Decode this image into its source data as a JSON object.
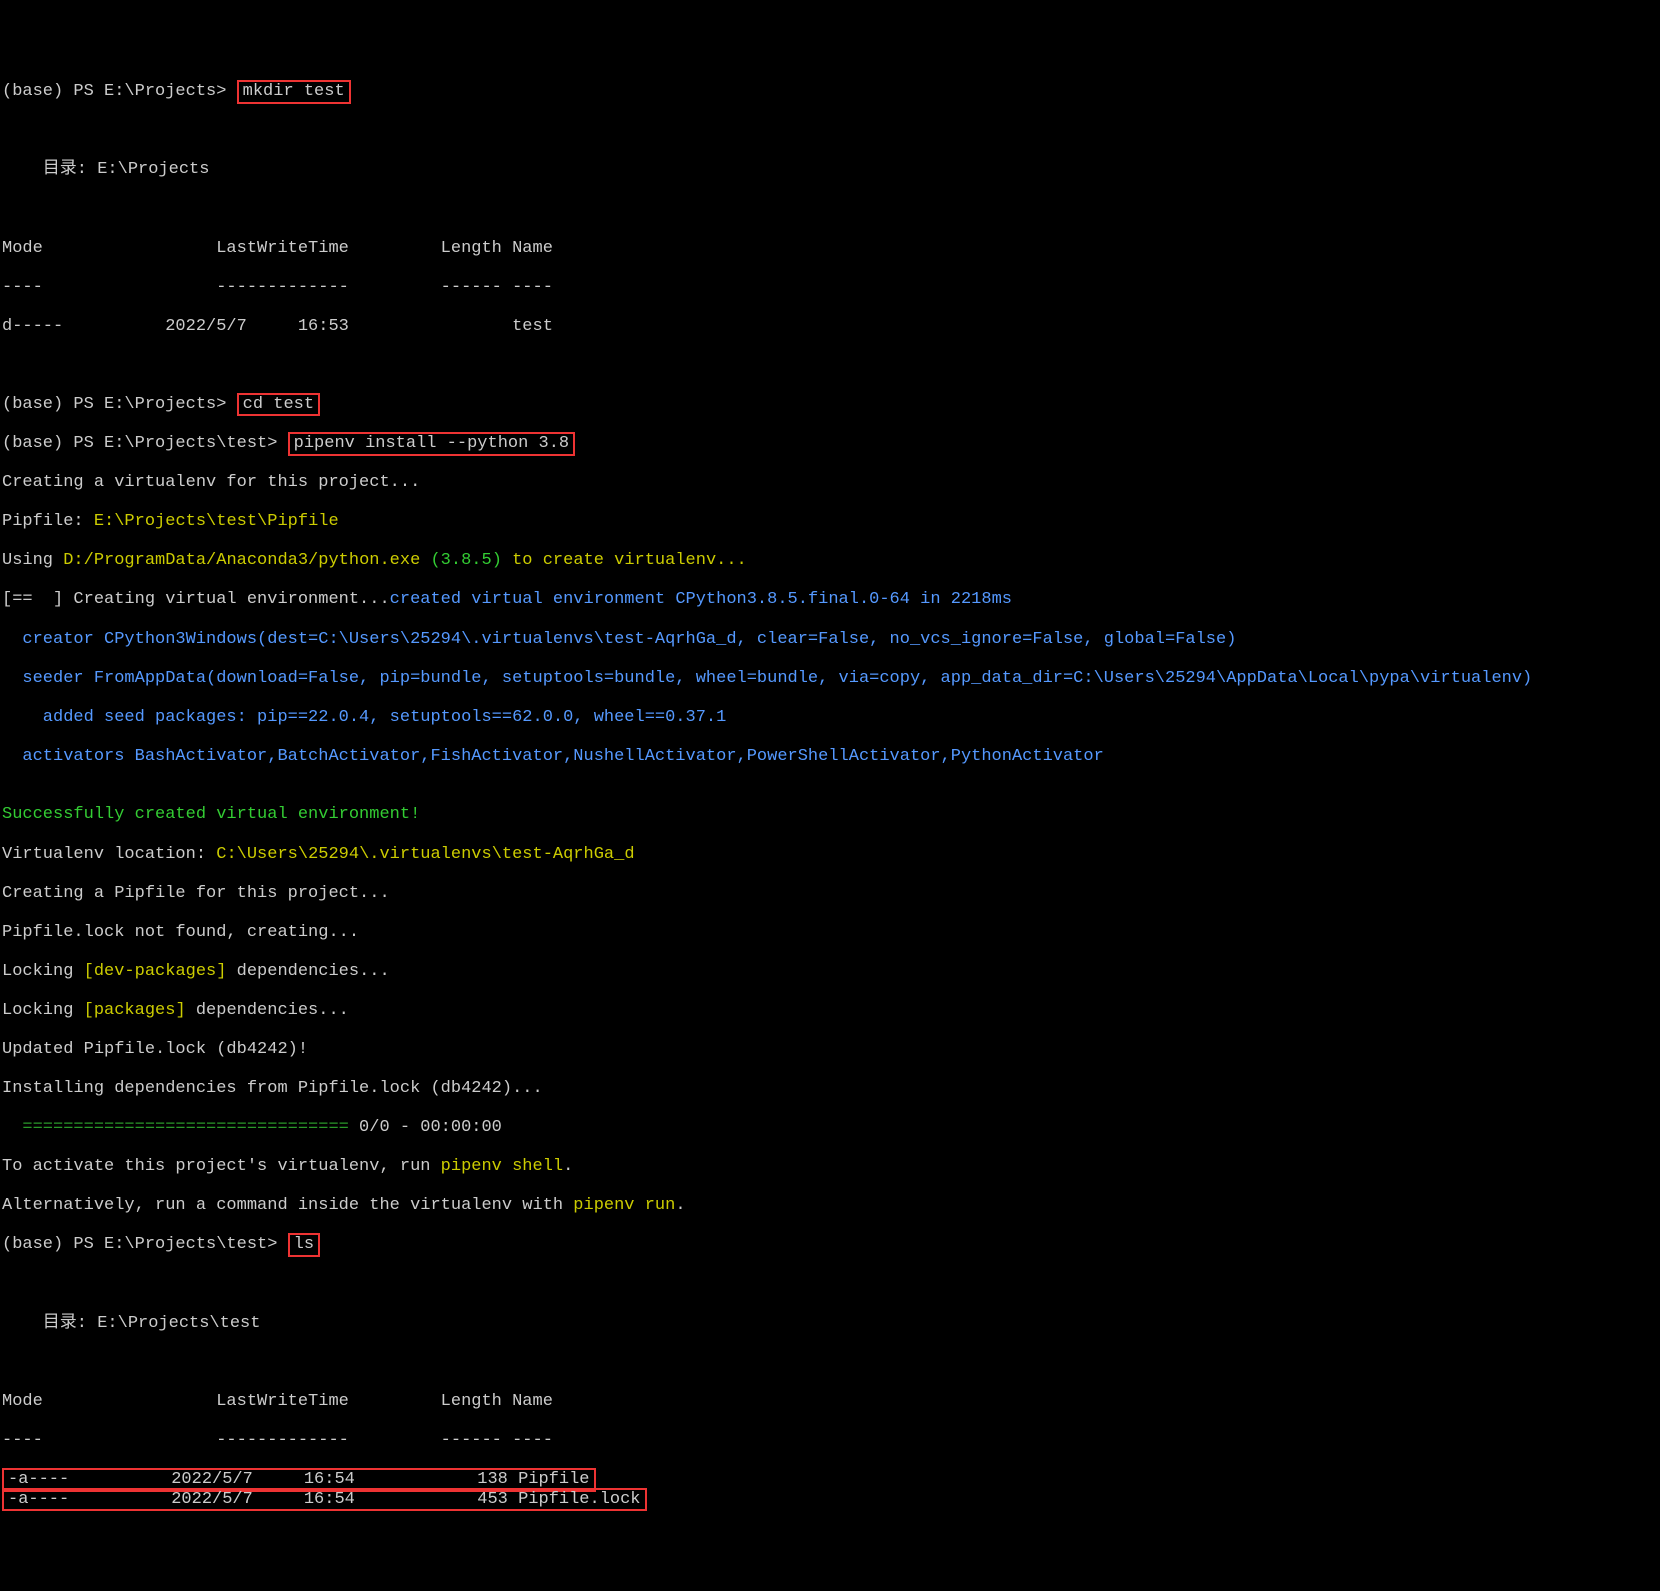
{
  "prompt1_prefix": "(base) PS E:\\Projects> ",
  "cmd1": "mkdir test",
  "blank": "",
  "dir1": "    目录: E:\\Projects",
  "hdr1_mode": "Mode                 LastWriteTime         Length Name",
  "hdr1_sep": "----                 -------------         ------ ----",
  "row1": "d-----          2022/5/7     16:53                test",
  "prompt2_prefix": "(base) PS E:\\Projects> ",
  "cmd2": "cd test",
  "prompt3_prefix": "(base) PS E:\\Projects\\test> ",
  "cmd3": "pipenv install --python 3.8",
  "creating1": "Creating a virtualenv for this project...",
  "pipfile_path_label": "Pipfile: ",
  "pipfile_path": "E:\\Projects\\test\\Pipfile",
  "using_pre": "Using ",
  "using_path": "D:/ProgramData/Anaconda3/python.exe",
  "using_ver": " (3.8.5)",
  "using_post": " to create virtualenv...",
  "env_pre": "[==  ] Creating virtual environment...",
  "env_created": "created virtual environment CPython3.8.5.final.0-64 in 2218ms",
  "creator": "  creator CPython3Windows(dest=C:\\Users\\25294\\.virtualenvs\\test-AqrhGa_d, clear=False, no_vcs_ignore=False, global=False)",
  "seeder": "  seeder FromAppData(download=False, pip=bundle, setuptools=bundle, wheel=bundle, via=copy, app_data_dir=C:\\Users\\25294\\AppData\\Local\\pypa\\virtualenv)",
  "added": "    added seed packages: pip==22.0.4, setuptools==62.0.0, wheel==0.37.1",
  "activators": "  activators BashActivator,BatchActivator,FishActivator,NushellActivator,PowerShellActivator,PythonActivator",
  "success": "Successfully created virtual environment!",
  "venv_loc_label": "Virtualenv location: ",
  "venv_loc": "C:\\Users\\25294\\.virtualenvs\\test-AqrhGa_d",
  "creating_pipfile": "Creating a Pipfile for this project...",
  "lock_not_found": "Pipfile.lock not found, creating...",
  "locking1_pre": "Locking",
  "locking1_mid": " [dev-packages] ",
  "locking1_post": "dependencies...",
  "locking2_pre": "Locking",
  "locking2_mid": " [packages] ",
  "locking2_post": "dependencies...",
  "updated": "Updated Pipfile.lock (db4242)!",
  "installing": "Installing dependencies from Pipfile.lock (db4242)...",
  "progress_bar": "  ================================",
  "progress_txt": " 0/0 - 00:00:00",
  "activate_pre": "To activate this project's virtualenv, run ",
  "activate_cmd": "pipenv shell",
  "activate_post": ".",
  "alt_pre": "Alternatively, run a command inside the virtualenv with ",
  "alt_cmd": "pipenv run",
  "alt_post": ".",
  "prompt4_prefix": "(base) PS E:\\Projects\\test> ",
  "cmd4": "ls",
  "dir2": "    目录: E:\\Projects\\test",
  "hdr2_mode": "Mode                 LastWriteTime         Length Name",
  "hdr2_sep": "----                 -------------         ------ ----",
  "row2a": "-a----          2022/5/7     16:54            138 Pipfile",
  "row2b": "-a----          2022/5/7     16:54            453 Pipfile.lock"
}
